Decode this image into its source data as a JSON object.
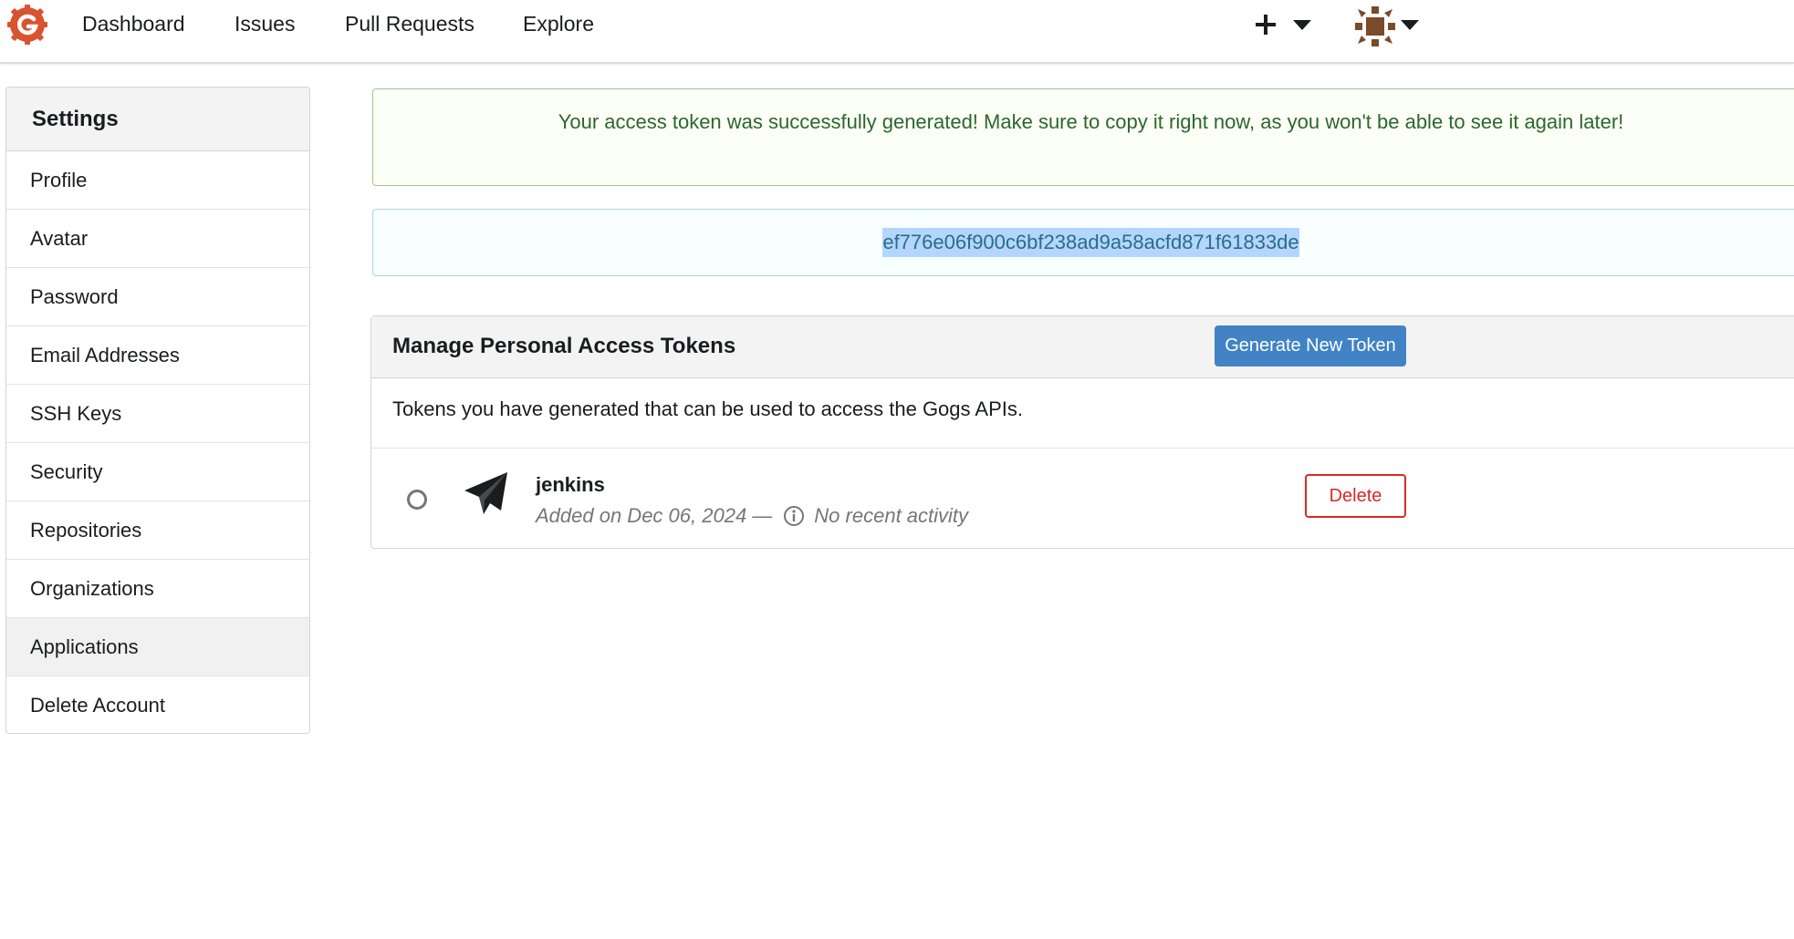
{
  "nav": {
    "logo_icon": "gogs-logo-icon",
    "items": [
      "Dashboard",
      "Issues",
      "Pull Requests",
      "Explore"
    ],
    "create_icon": "plus-icon",
    "avatar_icon": "user-avatar-icon"
  },
  "sidebar": {
    "header": "Settings",
    "items": [
      {
        "label": "Profile"
      },
      {
        "label": "Avatar"
      },
      {
        "label": "Password"
      },
      {
        "label": "Email Addresses"
      },
      {
        "label": "SSH Keys"
      },
      {
        "label": "Security"
      },
      {
        "label": "Repositories"
      },
      {
        "label": "Organizations"
      },
      {
        "label": "Applications",
        "active": true
      },
      {
        "label": "Delete Account"
      }
    ]
  },
  "success_message": "Your access token was successfully generated! Make sure to copy it right now, as you won't be able to see it again later!",
  "token_value": "ef776e06f900c6bf238ad9a58acfd871f61833de",
  "tokens_panel": {
    "title": "Manage Personal Access Tokens",
    "generate_button": "Generate New Token",
    "description": "Tokens you have generated that can be used to access the Gogs APIs.",
    "tokens": [
      {
        "icon": "send-icon",
        "name": "jenkins",
        "added": "Added on Dec 06, 2024 —",
        "activity": "No recent activity",
        "delete_label": "Delete"
      }
    ]
  },
  "colors": {
    "brand": "#d9532f",
    "primary_button": "#4183c4",
    "danger": "#db2828",
    "success_text": "#2c662d",
    "token_text": "#276f86"
  }
}
